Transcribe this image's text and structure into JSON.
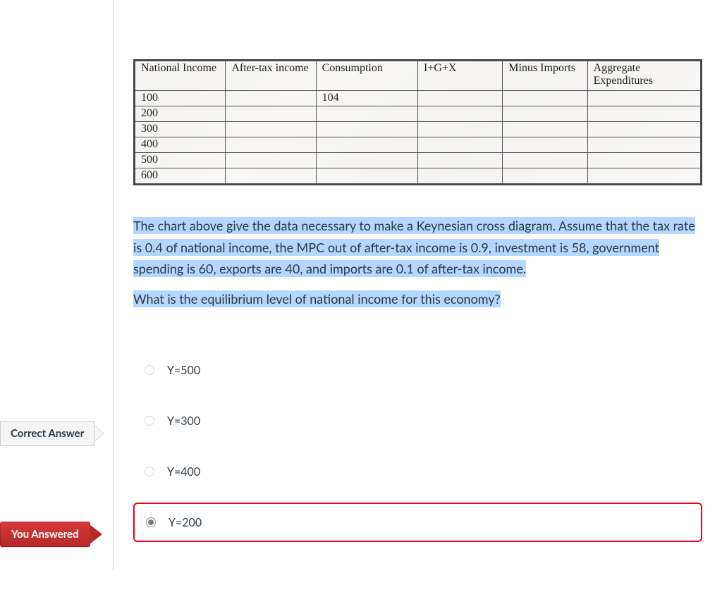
{
  "table": {
    "headers": [
      "National Income",
      "After-tax income",
      "Consumption",
      "I+G+X",
      "Minus Imports",
      "Aggregate Expenditures"
    ],
    "rows": [
      {
        "national_income": "100",
        "after_tax": "",
        "consumption": "104",
        "igx": "",
        "minus_imports": "",
        "ae": ""
      },
      {
        "national_income": "200",
        "after_tax": "",
        "consumption": "",
        "igx": "",
        "minus_imports": "",
        "ae": ""
      },
      {
        "national_income": "300",
        "after_tax": "",
        "consumption": "",
        "igx": "",
        "minus_imports": "",
        "ae": ""
      },
      {
        "national_income": "400",
        "after_tax": "",
        "consumption": "",
        "igx": "",
        "minus_imports": "",
        "ae": ""
      },
      {
        "national_income": "500",
        "after_tax": "",
        "consumption": "",
        "igx": "",
        "minus_imports": "",
        "ae": ""
      },
      {
        "national_income": "600",
        "after_tax": "",
        "consumption": "",
        "igx": "",
        "minus_imports": "",
        "ae": ""
      }
    ]
  },
  "question": {
    "para1": "The chart above give the data necessary to make a Keynesian cross diagram. Assume that the tax rate is 0.4 of national income, the MPC out of after-tax income is 0.9, investment is 58, government spending is 60, exports are 40, and imports are 0.1 of after-tax income.",
    "para2": "What is the equilibrium level of national income for this economy?"
  },
  "answers": {
    "options": [
      {
        "label": "Y=500",
        "selected": false,
        "is_correct": false,
        "is_user": false
      },
      {
        "label": "Y=300",
        "selected": false,
        "is_correct": true,
        "is_user": false
      },
      {
        "label": "Y=400",
        "selected": false,
        "is_correct": false,
        "is_user": false
      },
      {
        "label": "Y=200",
        "selected": true,
        "is_correct": false,
        "is_user": true
      }
    ]
  },
  "labels": {
    "correct_answer": "Correct Answer",
    "you_answered": "You Answered"
  }
}
